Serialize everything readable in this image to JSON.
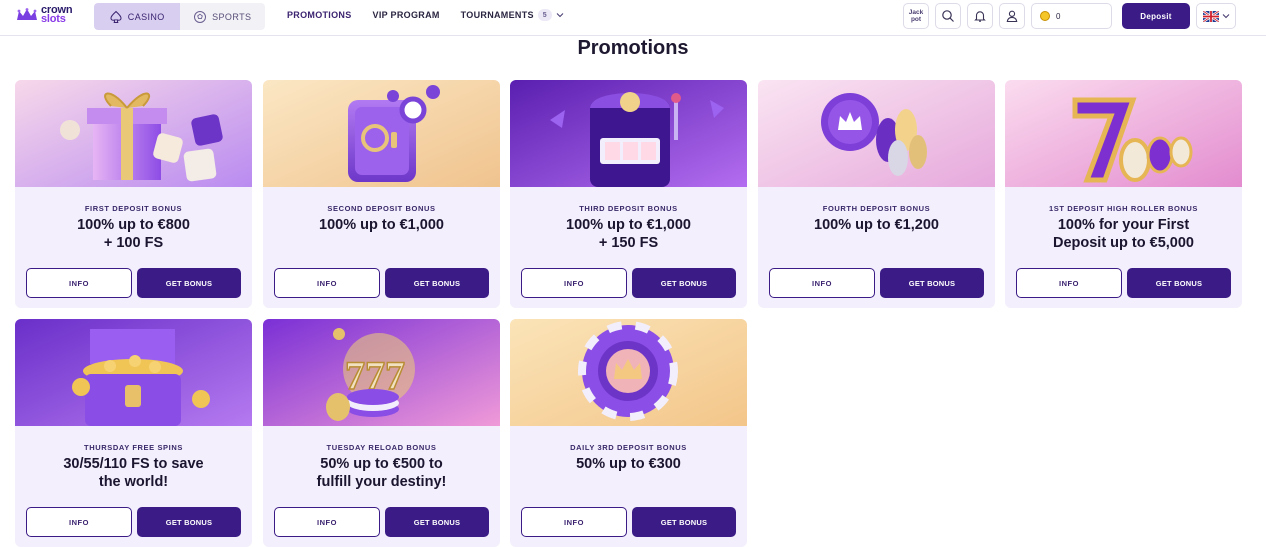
{
  "brand": {
    "line1": "crown",
    "line2": "slots"
  },
  "switch": {
    "casino": "Casino",
    "sports": "Sports"
  },
  "nav": {
    "promotions": "Promotions",
    "vip": "VIP Program",
    "tournaments": "Tournaments",
    "tournaments_count": "5"
  },
  "tools": {
    "jackpot_line1": "Jack",
    "jackpot_line2": "pot",
    "balance": "0",
    "deposit": "Deposit"
  },
  "page": {
    "title": "Promotions"
  },
  "cards": [
    {
      "subtitle": "First Deposit Bonus",
      "line1": "100% up to €800",
      "line2": "+ 100 FS",
      "info": "Info",
      "get": "Get Bonus"
    },
    {
      "subtitle": "Second Deposit Bonus",
      "line1": "100% up to €1,000",
      "line2": "",
      "info": "Info",
      "get": "Get Bonus"
    },
    {
      "subtitle": "Third Deposit Bonus",
      "line1": "100% up to €1,000",
      "line2": "+ 150 FS",
      "info": "Info",
      "get": "Get Bonus"
    },
    {
      "subtitle": "Fourth Deposit Bonus",
      "line1": "100% up to €1,200",
      "line2": "",
      "info": "Info",
      "get": "Get Bonus"
    },
    {
      "subtitle": "1st Deposit High Roller Bonus",
      "line1": "100% for your First",
      "line2": "Deposit up to €5,000",
      "info": "Info",
      "get": "Get Bonus"
    },
    {
      "subtitle": "Thursday Free Spins",
      "line1": "30/55/110 FS to save",
      "line2": "the world!",
      "info": "Info",
      "get": "Get Bonus"
    },
    {
      "subtitle": "Tuesday Reload Bonus",
      "line1": "50% up to €500 to",
      "line2": "fulfill your destiny!",
      "info": "Info",
      "get": "Get Bonus"
    },
    {
      "subtitle": "Daily 3rd Deposit Bonus",
      "line1": "50% up to €300",
      "line2": "",
      "info": "Info",
      "get": "Get Bonus"
    }
  ]
}
